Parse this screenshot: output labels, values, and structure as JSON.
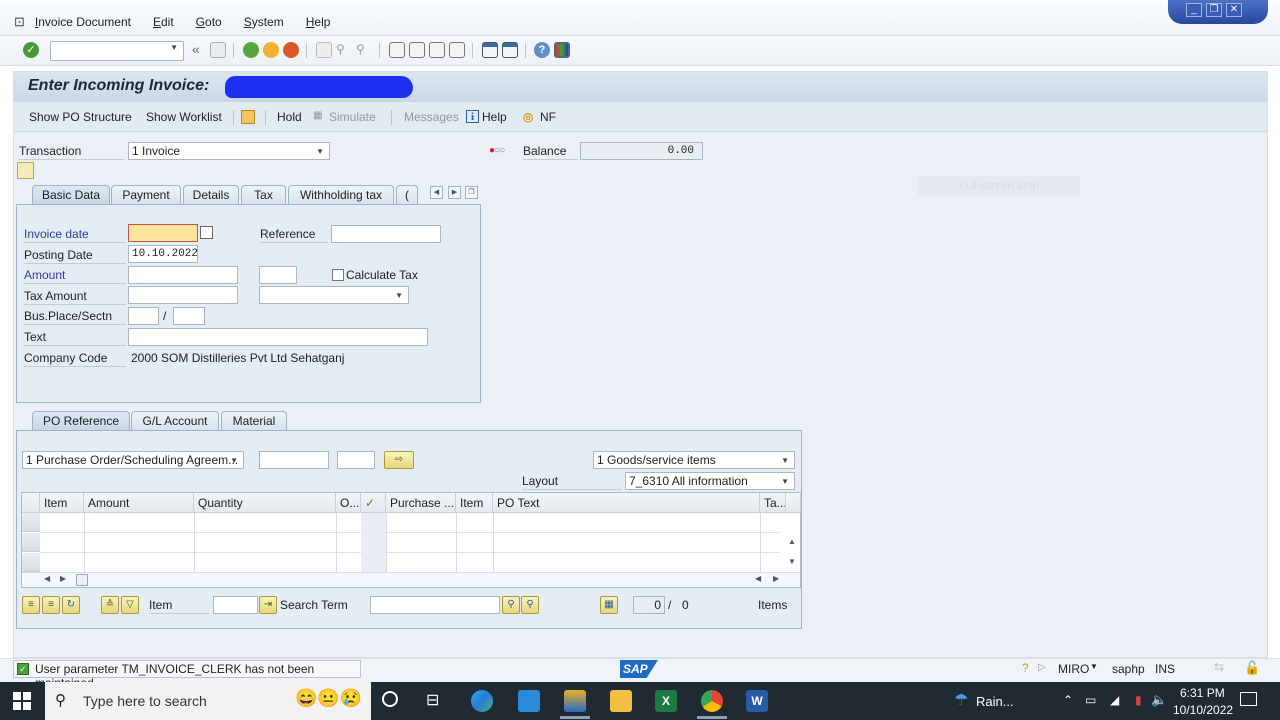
{
  "window": {
    "menu": [
      "Invoice Document",
      "Edit",
      "Goto",
      "System",
      "Help"
    ],
    "controls": {
      "minimize": "minimize-icon",
      "restore": "restore-icon",
      "close": "close-icon"
    }
  },
  "toolbar": {
    "command_field": "",
    "icons": [
      "enter-icon",
      "back-icon",
      "save-icon",
      "back-green-icon",
      "exit-icon",
      "cancel-icon",
      "print-icon",
      "find-icon",
      "find-next-icon",
      "first-page-icon",
      "prev-page-icon",
      "next-page-icon",
      "last-page-icon",
      "new-session-icon",
      "shortcut-icon",
      "help-icon",
      "layout-icon"
    ]
  },
  "page": {
    "title": "Enter Incoming Invoice:",
    "title_redacted": true
  },
  "app_toolbar": {
    "show_po_structure": "Show PO Structure",
    "show_worklist": "Show Worklist",
    "hold": "Hold",
    "simulate": "Simulate",
    "messages": "Messages",
    "help": "Help",
    "nf": "NF"
  },
  "header": {
    "transaction_label": "Transaction",
    "transaction_value": "1 Invoice",
    "balance_label": "Balance",
    "balance_value": "0.00",
    "status_light": "red",
    "fullscreen_snip": "Full-screen Snip"
  },
  "basic_tabs": [
    "Basic Data",
    "Payment",
    "Details",
    "Tax",
    "Withholding tax",
    "("
  ],
  "basic_data": {
    "invoice_date_label": "Invoice date",
    "invoice_date_value": "",
    "reference_label": "Reference",
    "reference_value": "",
    "posting_date_label": "Posting Date",
    "posting_date_value": "10.10.2022",
    "amount_label": "Amount",
    "amount_value": "",
    "currency_value": "",
    "calculate_tax_label": "Calculate Tax",
    "calculate_tax_checked": false,
    "tax_amount_label": "Tax Amount",
    "tax_amount_value": "",
    "tax_code_value": "",
    "bus_place_label": "Bus.Place/Sectn",
    "bus_place_value": "",
    "section_value": "",
    "slash": "/",
    "text_label": "Text",
    "text_value": "",
    "company_code_label": "Company Code",
    "company_code_value": "2000 SOM Distilleries Pvt Ltd Sehatganj"
  },
  "po_tabs": [
    "PO Reference",
    "G/L Account",
    "Material"
  ],
  "po_reference": {
    "doc_type": "1 Purchase Order/Scheduling Agreem...",
    "doc_number": "",
    "doc_item": "",
    "items_type": "1 Goods/service items",
    "layout_label": "Layout",
    "layout_value": "7_6310 All information",
    "columns": [
      "Item",
      "Amount",
      "Quantity",
      "O...",
      "",
      "Purchase ...",
      "Item",
      "PO Text",
      "Ta..."
    ],
    "rows": [
      [],
      [],
      []
    ],
    "item_label": "Item",
    "item_value": "",
    "search_term_label": "Search Term",
    "search_term_value": "",
    "count_current": "0",
    "count_sep": "/",
    "count_total": "0",
    "items_label": "Items"
  },
  "status": {
    "message": "User parameter TM_INVOICE_CLERK  has not been maintained",
    "brand": "SAP",
    "transaction": "MIRO",
    "server": "saphp",
    "mode": "INS"
  },
  "taskbar": {
    "search_placeholder": "Type here to search",
    "weather": "Rain...",
    "time": "6:31 PM",
    "date": "10/10/2022"
  }
}
